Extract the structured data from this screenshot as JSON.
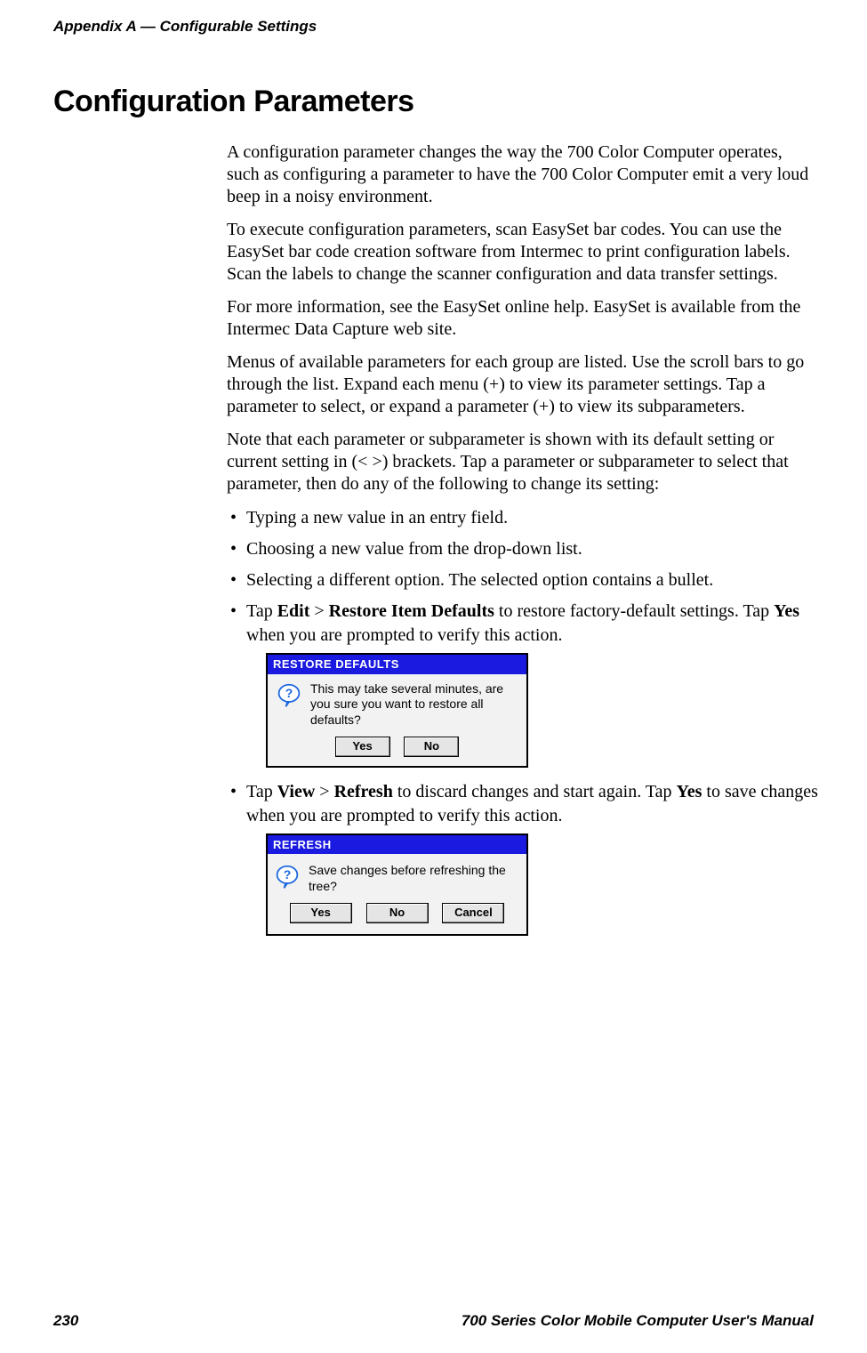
{
  "header": {
    "appendix_label": "Appendix A",
    "sep": " —  ",
    "section": "Configurable Settings"
  },
  "title": "Configuration Parameters",
  "paragraphs": {
    "p1": "A configuration parameter changes the way the 700 Color Computer operates, such as configuring a parameter to have the 700 Color Computer emit a very loud beep in a noisy environment.",
    "p2": "To execute configuration parameters, scan EasySet bar codes. You can use the EasySet bar code creation software from Intermec to print configuration labels. Scan the labels to change the scanner configuration and data transfer settings.",
    "p3": "For more information, see the EasySet online help. EasySet is available from the Intermec Data Capture web site.",
    "p4": "Menus of available parameters for each group are listed. Use the scroll bars to go through the list. Expand each menu (+) to view its parameter settings. Tap a parameter to select, or expand a parameter (+) to view its subparameters.",
    "p5": "Note that each parameter or subparameter is shown with its default setting or current setting in (< >) brackets. Tap a parameter or subparameter to select that parameter, then do any of the following to change its setting:"
  },
  "bullets": {
    "b1": "Typing a new value in an entry field.",
    "b2": "Choosing a new value from the drop-down list.",
    "b3": "Selecting a different option. The selected option contains a bullet.",
    "b4_pre": "Tap ",
    "b4_edit": "Edit",
    "b4_gt": " > ",
    "b4_restore": "Restore Item Defaults",
    "b4_post": " to restore factory-default settings. Tap ",
    "b4_yes": "Yes",
    "b4_tail": " when you are prompted to verify this action.",
    "b5_pre": "Tap ",
    "b5_view": "View",
    "b5_gt": "  > ",
    "b5_refresh": "Refresh",
    "b5_mid": " to discard changes and start again. Tap ",
    "b5_yes": "Yes",
    "b5_tail": " to save changes when you are prompted to verify this action."
  },
  "dialogs": {
    "restore": {
      "title": "RESTORE DEFAULTS",
      "message": "This may take several minutes, are you sure you want to restore all defaults?",
      "buttons": {
        "yes": "Yes",
        "no": "No"
      }
    },
    "refresh": {
      "title": "REFRESH",
      "message": "Save changes before refreshing the tree?",
      "buttons": {
        "yes": "Yes",
        "no": "No",
        "cancel": "Cancel"
      }
    }
  },
  "footer": {
    "page": "230",
    "manual": "700 Series Color Mobile Computer User's Manual"
  },
  "icons": {
    "question": "question-balloon-icon"
  }
}
